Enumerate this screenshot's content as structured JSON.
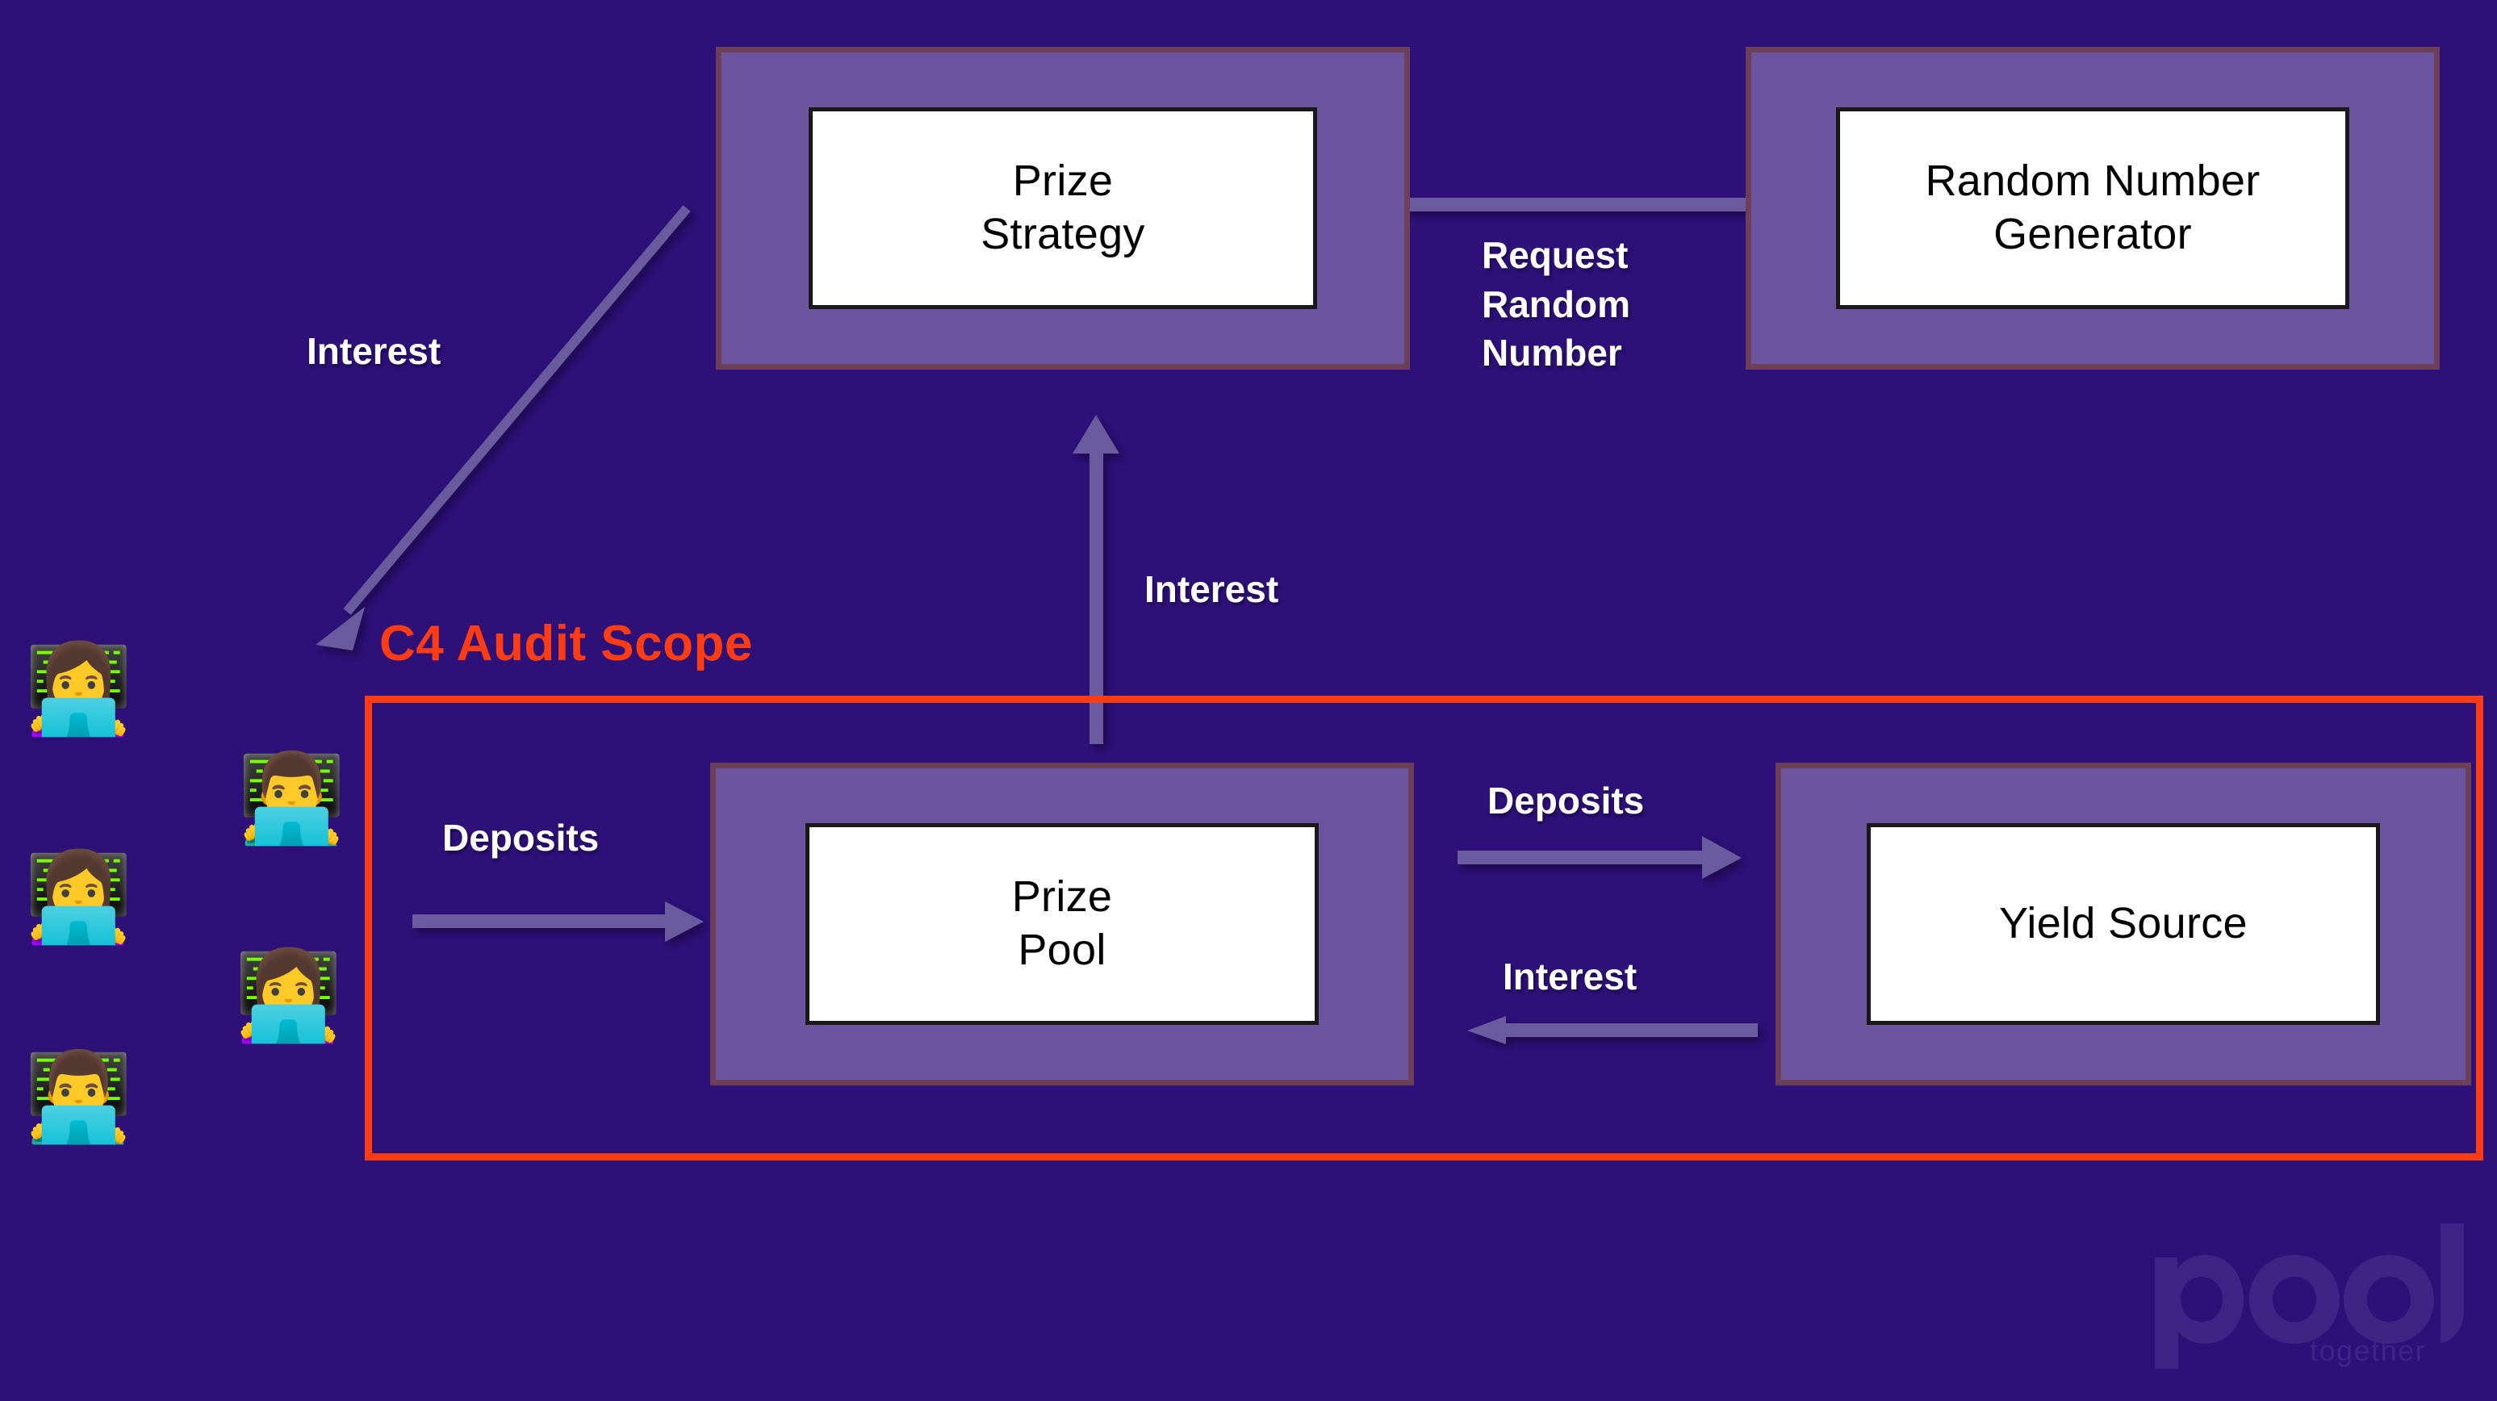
{
  "background_color": "#2d1078",
  "palette": {
    "canvas": "#2d1078",
    "node_fill": "#6b559f",
    "node_border": "#6d3f59",
    "node_inner_fill": "#ffffff",
    "node_inner_border": "#191919",
    "arrow": "#6a5a9e",
    "scope_red": "#ff3c14",
    "label_text": "#ffffff",
    "watermark": "#3c2382"
  },
  "nodes": [
    {
      "id": "prize-strategy",
      "label": "Prize\nStrategy"
    },
    {
      "id": "random-number-generator",
      "label": "Random Number\nGenerator"
    },
    {
      "id": "prize-pool",
      "label": "Prize\nPool"
    },
    {
      "id": "yield-source",
      "label": "Yield Source"
    }
  ],
  "scope": {
    "title": "C4 Audit Scope",
    "color": "#ff3c14"
  },
  "edges": [
    {
      "id": "interest-to-users",
      "label": "Interest",
      "from": "prize-strategy",
      "to": "users",
      "direction": "down-left"
    },
    {
      "id": "request-random",
      "label": "Request\nRandom\nNumber",
      "from": "prize-strategy",
      "to": "random-number-generator",
      "direction": "right"
    },
    {
      "id": "interest-to-strategy",
      "label": "Interest",
      "from": "prize-pool",
      "to": "prize-strategy",
      "direction": "up"
    },
    {
      "id": "deposits-from-users",
      "label": "Deposits",
      "from": "users",
      "to": "prize-pool",
      "direction": "right"
    },
    {
      "id": "deposits-to-yield",
      "label": "Deposits",
      "from": "prize-pool",
      "to": "yield-source",
      "direction": "right"
    },
    {
      "id": "interest-from-yield",
      "label": "Interest",
      "from": "yield-source",
      "to": "prize-pool",
      "direction": "left"
    }
  ],
  "users": [
    {
      "id": "user-1",
      "icon": "woman-technologist-emoji",
      "glyph": "👩‍💻"
    },
    {
      "id": "user-2",
      "icon": "man-technologist-emoji",
      "glyph": "👨‍💻"
    },
    {
      "id": "user-3",
      "icon": "woman-technologist-emoji",
      "glyph": "👩‍💻"
    },
    {
      "id": "user-4",
      "icon": "woman-technologist-emoji",
      "glyph": "👩‍💻"
    },
    {
      "id": "user-5",
      "icon": "man-technologist-emoji",
      "glyph": "👨‍💻"
    }
  ],
  "watermark": {
    "wordmark": "pool",
    "tagline": "together"
  }
}
